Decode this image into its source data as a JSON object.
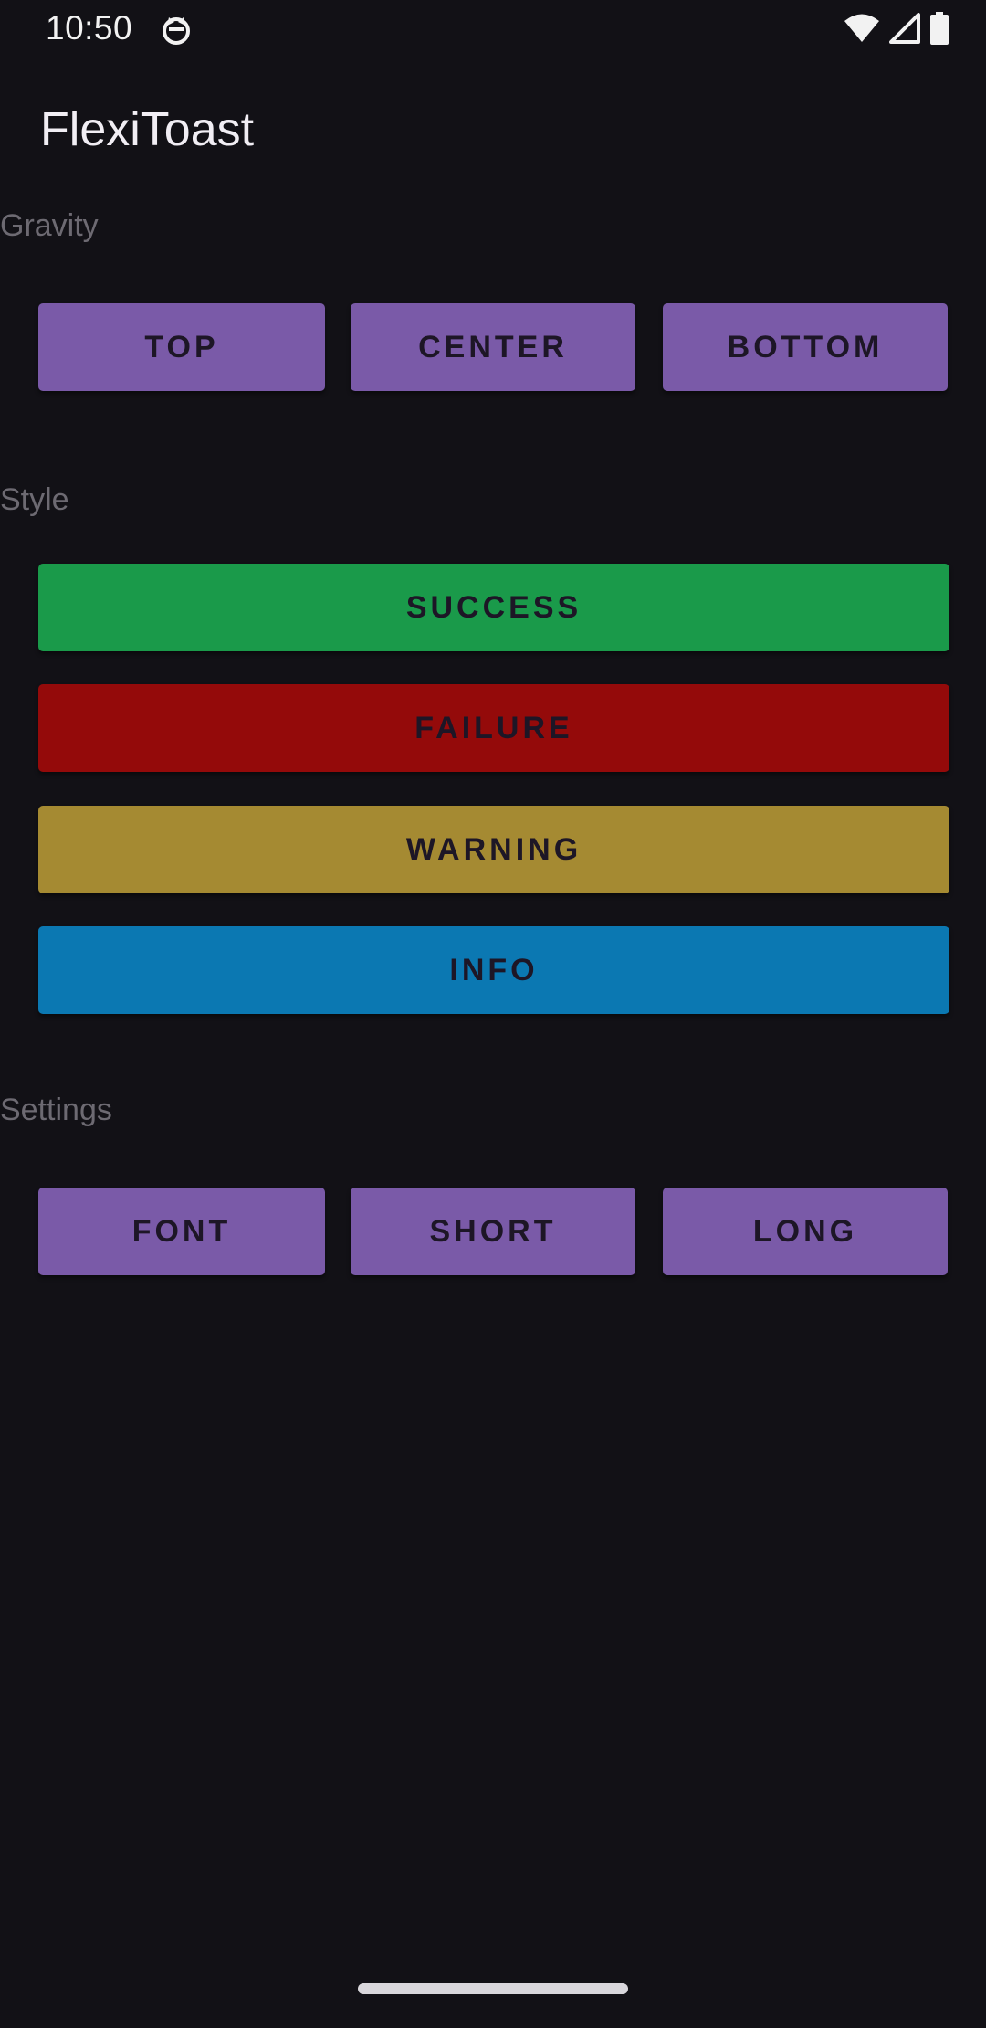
{
  "status_bar": {
    "time": "10:50",
    "app_icon": "cat-notification-icon",
    "wifi_icon": "wifi-icon",
    "signal_icon": "cell-signal-icon",
    "battery_icon": "battery-icon"
  },
  "app_bar": {
    "title": "FlexiToast"
  },
  "gravity": {
    "label": "Gravity",
    "buttons": [
      "TOP",
      "CENTER",
      "BOTTOM"
    ]
  },
  "style": {
    "label": "Style",
    "buttons": [
      {
        "label": "SUCCESS",
        "color": "#1a9a4a"
      },
      {
        "label": "FAILURE",
        "color": "#940a0a"
      },
      {
        "label": "WARNING",
        "color": "#a58a32"
      },
      {
        "label": "INFO",
        "color": "#0b78b2"
      }
    ]
  },
  "settings": {
    "label": "Settings",
    "buttons": [
      "FONT",
      "SHORT",
      "LONG"
    ]
  },
  "colors": {
    "background": "#121116",
    "button_purple": "#7a5aa8",
    "button_text": "#1d1626",
    "section_label": "#6d6a72"
  }
}
